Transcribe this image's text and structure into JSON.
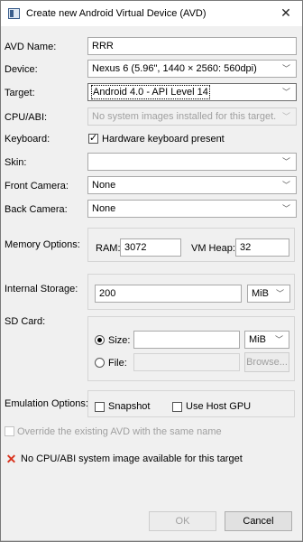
{
  "window": {
    "title": "Create new Android Virtual Device (AVD)"
  },
  "form": {
    "avd_name": {
      "label": "AVD Name:",
      "value": "RRR"
    },
    "device": {
      "label": "Device:",
      "value": "Nexus 6 (5.96\", 1440 × 2560: 560dpi)"
    },
    "target": {
      "label": "Target:",
      "value": "Android 4.0 - API Level 14"
    },
    "cpu_abi": {
      "label": "CPU/ABI:",
      "value": "No system images installed for this target."
    },
    "keyboard": {
      "label": "Keyboard:",
      "checkbox_label": "Hardware keyboard present",
      "checked": true
    },
    "skin": {
      "label": "Skin:",
      "value": ""
    },
    "front_camera": {
      "label": "Front Camera:",
      "value": "None"
    },
    "back_camera": {
      "label": "Back Camera:",
      "value": "None"
    },
    "memory": {
      "label": "Memory Options:",
      "ram_label": "RAM:",
      "ram_value": "3072",
      "vm_heap_label": "VM Heap:",
      "vm_heap_value": "32"
    },
    "internal_storage": {
      "label": "Internal Storage:",
      "value": "200",
      "unit": "MiB"
    },
    "sd_card": {
      "label": "SD Card:",
      "size_label": "Size:",
      "size_value": "",
      "size_unit": "MiB",
      "file_label": "File:",
      "file_value": "",
      "browse_label": "Browse..."
    },
    "emulation": {
      "label": "Emulation Options:",
      "snapshot_label": "Snapshot",
      "host_gpu_label": "Use Host GPU"
    },
    "override": {
      "label": "Override the existing AVD with the same name"
    }
  },
  "error": {
    "message": "No CPU/ABI system image available for this target",
    "color": "#d9341f"
  },
  "buttons": {
    "ok": "OK",
    "cancel": "Cancel"
  }
}
